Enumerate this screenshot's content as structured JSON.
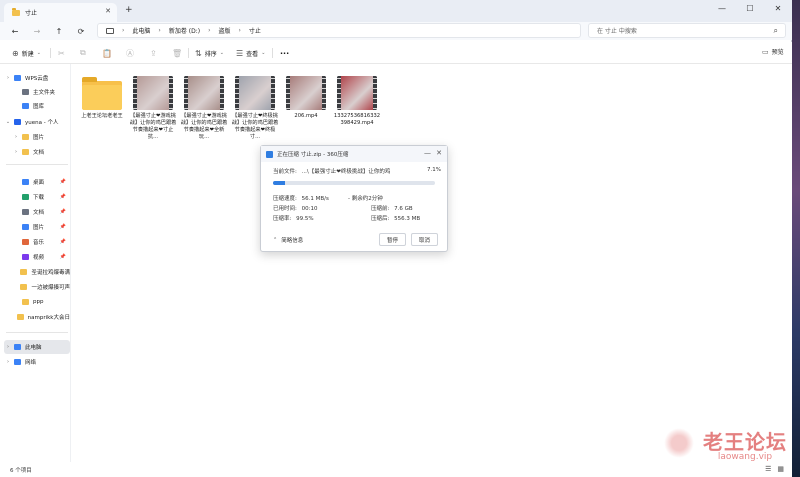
{
  "titlebar": {
    "tab_title": "寸止",
    "tab_close": "✕",
    "new_tab": "+",
    "minimize": "—",
    "maximize": "☐",
    "close": "✕"
  },
  "navigation": {
    "back": "←",
    "forward": "→",
    "up": "↑",
    "refresh": "⟳",
    "breadcrumbs": [
      "此电脑",
      "新加卷 (D:)",
      "盗版",
      "寸止"
    ],
    "crumb_sep": "›",
    "search_placeholder": "在 寸止 中搜索",
    "search_icon": "⌕"
  },
  "toolbar": {
    "new_label": "新建",
    "new_icon": "⊕",
    "cut_icon": "✂",
    "copy_icon": "⧉",
    "paste_icon": "📋",
    "rename_icon": "Ⓐ",
    "share_icon": "⇪",
    "delete_icon": "🗑",
    "sort_label": "排序",
    "sort_icon": "⇅",
    "view_label": "查看",
    "view_icon": "☰",
    "more_label": "···",
    "preview_label": "预览",
    "preview_icon": "▭"
  },
  "sidebar": {
    "items": [
      {
        "label": "WPS云盘",
        "chev": "›",
        "color": "#3b82f6",
        "pinned": false
      },
      {
        "label": "主文件夹",
        "chev": "",
        "color": "#6b7280",
        "pinned": false
      },
      {
        "label": "图库",
        "chev": "",
        "color": "#3b82f6",
        "pinned": false
      },
      {
        "label": "yuena - 个人",
        "chev": "⌄",
        "color": "#2563eb",
        "pinned": false
      },
      {
        "label": "图片",
        "chev": "›",
        "color": "#f2c14e",
        "pinned": false
      },
      {
        "label": "文档",
        "chev": "›",
        "color": "#f2c14e",
        "pinned": false
      },
      {
        "label": "桌面",
        "chev": "",
        "color": "#3b82f6",
        "pinned": true
      },
      {
        "label": "下载",
        "chev": "",
        "color": "#22a06b",
        "pinned": true
      },
      {
        "label": "文档",
        "chev": "",
        "color": "#6b7280",
        "pinned": true
      },
      {
        "label": "图片",
        "chev": "",
        "color": "#3b82f6",
        "pinned": true
      },
      {
        "label": "音乐",
        "chev": "",
        "color": "#e0663b",
        "pinned": true
      },
      {
        "label": "视频",
        "chev": "",
        "color": "#7c3aed",
        "pinned": true
      },
      {
        "label": "圣诞拉鸡爆毒满",
        "chev": "",
        "color": "#f2c14e",
        "pinned": false
      },
      {
        "label": "一边被爆揍可声",
        "chev": "",
        "color": "#f2c14e",
        "pinned": false
      },
      {
        "label": "ppp",
        "chev": "",
        "color": "#f2c14e",
        "pinned": false
      },
      {
        "label": "namprikk大会日",
        "chev": "",
        "color": "#f2c14e",
        "pinned": false
      },
      {
        "label": "此电脑",
        "chev": "›",
        "color": "#3b82f6",
        "pinned": false,
        "selected": true
      },
      {
        "label": "网络",
        "chev": "›",
        "color": "#3b82f6",
        "pinned": false
      }
    ],
    "pin_glyph": "📌"
  },
  "files": [
    {
      "name": "上老王论坛老老王",
      "type": "folder"
    },
    {
      "name": "【最强寸止❤游戏挑战】让你的鸡巴跟着节奏撸起来❤寸止抗...",
      "type": "video",
      "tint": "#b59a97"
    },
    {
      "name": "【最强寸止❤游戏挑战】让你的鸡巴跟着节奏撸起来❤全新玩...",
      "type": "video",
      "tint": "#a88f8a"
    },
    {
      "name": "【最强寸止❤终极挑战】让你的鸡巴跟着节奏撸起来❤终极寸...",
      "type": "video",
      "tint": "#9fa3ad"
    },
    {
      "name": "206.mp4",
      "type": "video",
      "tint": "#a77c7a"
    },
    {
      "name": "13327536816332398429.mp4",
      "type": "video",
      "tint": "#b0444b"
    }
  ],
  "dialog": {
    "title": "正在压缩 寸止.zip - 360压缩",
    "current_file_label": "当前文件:",
    "current_file_value": "...\\【最强寸止❤终极挑战】让你的鸡",
    "percent": "7.1%",
    "progress_fraction": 0.071,
    "speed_label": "压缩速度:",
    "speed_value": "56.1 MB/s",
    "remaining": "- 剩余约2分钟",
    "elapsed_label": "已用时间:",
    "elapsed_value": "00:10",
    "ratio_label": "压缩率:",
    "ratio_value": "99.5%",
    "before_label": "压缩前:",
    "before_value": "7.6 GB",
    "after_label": "压缩后:",
    "after_value": "556.3 MB",
    "less_info": "简略信息",
    "less_caret": "⌃",
    "pause_label": "暂停",
    "cancel_label": "取消",
    "min_glyph": "—",
    "close_glyph": "✕"
  },
  "statusbar": {
    "item_count": "6 个项目",
    "details_view_icon": "☰",
    "tiles_view_icon": "▦"
  },
  "watermark": {
    "title": "老王论坛",
    "url": "laowang.vip"
  }
}
